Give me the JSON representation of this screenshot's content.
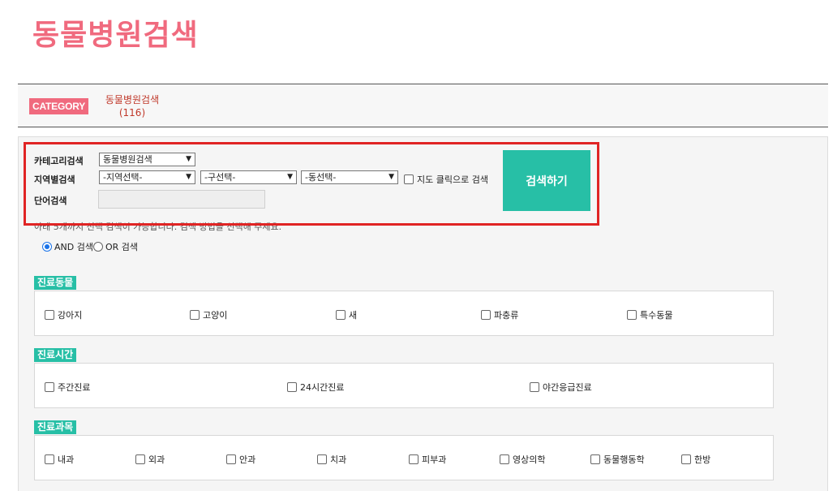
{
  "page": {
    "title": "동물병원검색"
  },
  "category": {
    "badge": "CATEGORY",
    "link_label": "동물병원검색",
    "count": "(116)"
  },
  "search": {
    "category_label": "카테고리검색",
    "category_value": "동물병원검색",
    "region_label": "지역별검색",
    "region_select_1": "-지역선택-",
    "region_select_2": "-구선택-",
    "region_select_3": "-동선택-",
    "map_search_label": "지도 클릭으로 검색",
    "word_label": "단어검색",
    "word_value": "",
    "button_label": "검색하기",
    "notice": "아래 5개까지 선택 검색이 가능합니다. 검색 방법을 선택해 주세요.",
    "and_label": "AND 검색",
    "or_label": "OR 검색"
  },
  "sections": {
    "animals": {
      "title": "진료동물",
      "options": [
        "강아지",
        "고양이",
        "새",
        "파충류",
        "특수동물"
      ]
    },
    "hours": {
      "title": "진료시간",
      "options": [
        "주간진료",
        "24시간진료",
        "야간응급진료"
      ]
    },
    "subjects": {
      "title": "진료과목",
      "options": [
        "내과",
        "외과",
        "안과",
        "치과",
        "피부과",
        "영상의학",
        "동물행동학",
        "한방"
      ]
    }
  },
  "colors": {
    "accent_pink": "#f06a7e",
    "accent_teal": "#27bfa6",
    "highlight_red": "#e02424"
  },
  "icons": {
    "select_arrow": "chevron-down-icon"
  }
}
